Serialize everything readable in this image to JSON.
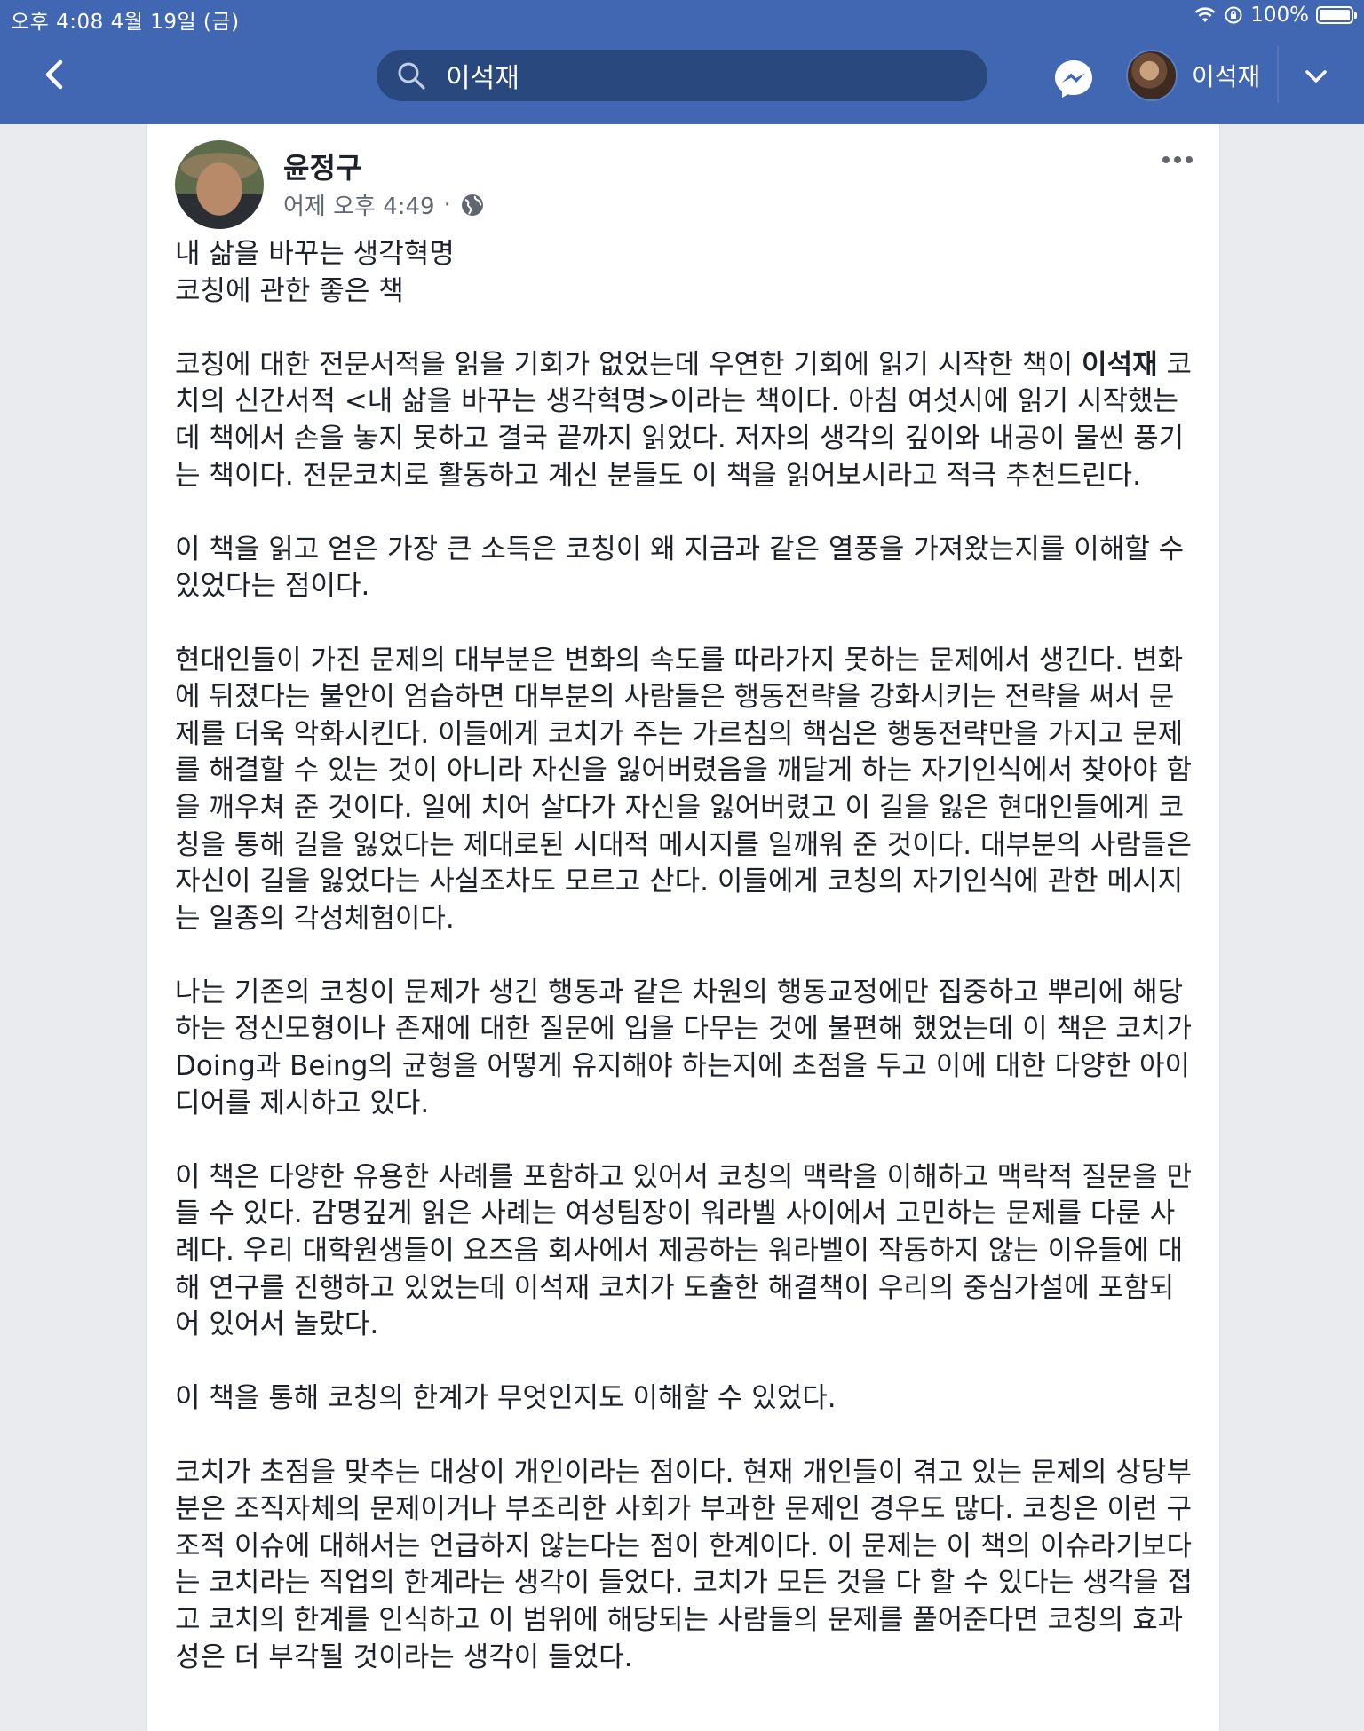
{
  "status_bar": {
    "time_date": "오후 4:08   4월 19일 (금)",
    "battery": "100%",
    "battery_level": 1.0
  },
  "nav": {
    "search_query": "이석재",
    "profile_name": "이석재",
    "icons": [
      "back-arrow-icon",
      "search-icon",
      "messenger-icon",
      "chevron-down-icon"
    ]
  },
  "colors": {
    "brand": "#4267b2",
    "search_bg": "#29487d",
    "text": "#1d2129",
    "meta": "#606770"
  },
  "post": {
    "author": "윤정구",
    "timestamp": "어제 오후 4:49",
    "meta_separator": "·",
    "privacy_icon": "globe-icon",
    "headline_1": "내 삶을 바꾸는 생각혁명",
    "headline_2": "코칭에 관한 좋은 책",
    "p1_before": "코칭에 대한 전문서적을 읽을 기회가 없었는데 우연한 기회에 읽기 시작한 책이 ",
    "p1_mention": "이석재",
    "p1_after": " 코치의 신간서적 <내  삶을 바꾸는 생각혁명>이라는 책이다. 아침 여섯시에 읽기 시작했는데 책에서 손을 놓지 못하고 결국 끝까지 읽었다. 저자의 생각의 깊이와 내공이 물씬 풍기는 책이다. 전문코치로 활동하고 계신 분들도 이 책을 읽어보시라고 적극 추천드린다.",
    "p2": "이 책을 읽고 얻은 가장 큰 소득은 코칭이 왜 지금과 같은 열풍을 가져왔는지를 이해할 수 있었다는 점이다.",
    "p3": "현대인들이 가진 문제의 대부분은 변화의 속도를 따라가지 못하는 문제에서 생긴다. 변화에 뒤졌다는 불안이 엄습하면 대부분의 사람들은 행동전략을 강화시키는 전략을 써서 문제를 더욱 악화시킨다. 이들에게 코치가 주는 가르침의 핵심은 행동전략만을 가지고 문제를 해결할 수 있는 것이 아니라 자신을 잃어버렸음을 깨달게 하는 자기인식에서 찾아야 함을 깨우쳐 준 것이다. 일에 치어 살다가 자신을 잃어버렸고 이 길을 잃은 현대인들에게 코칭을 통해 길을 잃었다는 제대로된 시대적 메시지를 일깨워 준 것이다. 대부분의 사람들은 자신이 길을 잃었다는 사실조차도 모르고 산다. 이들에게 코칭의 자기인식에 관한 메시지는 일종의 각성체험이다.",
    "p4": "나는 기존의 코칭이 문제가 생긴 행동과 같은 차원의 행동교정에만 집중하고 뿌리에 해당하는 정신모형이나 존재에 대한 질문에 입을 다무는 것에 불편해 했었는데 이 책은 코치가 Doing과 Being의 균형을 어떻게 유지해야 하는지에 초점을 두고 이에 대한 다양한 아이디어를 제시하고 있다.",
    "p5": "이 책은 다양한 유용한 사례를 포함하고 있어서 코칭의 맥락을 이해하고 맥락적 질문을 만들 수 있다. 감명깊게 읽은 사례는 여성팀장이 워라벨 사이에서 고민하는 문제를 다룬 사례다. 우리 대학원생들이 요즈음 회사에서 제공하는 워라벨이 작동하지 않는 이유들에 대해 연구를 진행하고 있었는데 이석재 코치가 도출한 해결책이 우리의 중심가설에 포함되어 있어서 놀랐다.",
    "p6": "이 책을 통해 코칭의 한계가 무엇인지도 이해할 수 있었다.",
    "p7": "코치가 초점을 맞추는 대상이 개인이라는 점이다. 현재 개인들이 겪고 있는 문제의 상당부분은 조직자체의 문제이거나 부조리한 사회가 부과한 문제인 경우도 많다. 코칭은 이런 구조적 이슈에 대해서는 언급하지 않는다는 점이 한계이다. 이 문제는 이 책의 이슈라기보다는 코치라는 직업의 한계라는 생각이 들었다. 코치가 모든 것을 다 할 수 있다는 생각을 접고 코치의 한계를 인식하고 이 범위에 해당되는 사람들의 문제를 풀어준다면 코칭의 효과성은 더 부각될 것이라는 생각이 들었다."
  }
}
